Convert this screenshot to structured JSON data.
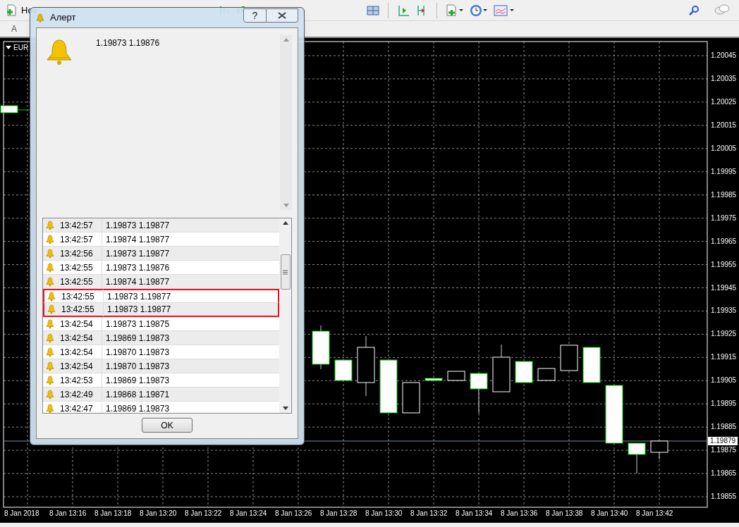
{
  "toolbar": {
    "new_order_label": "Нов",
    "row2_label": "A"
  },
  "chart": {
    "symbol": "EUR",
    "price_ticks": [
      "1.20045",
      "1.20035",
      "1.20025",
      "1.20015",
      "1.20005",
      "1.19995",
      "1.19985",
      "1.19975",
      "1.19965",
      "1.19955",
      "1.19945",
      "1.19935",
      "1.19925",
      "1.19915",
      "1.19905",
      "1.19895",
      "1.19885",
      "1.19875",
      "1.19865",
      "1.19855"
    ],
    "current_price": "1.19879",
    "time_labels": [
      "8 Jan 2018",
      "8 Jan 13:16",
      "8 Jan 13:18",
      "8 Jan 13:20",
      "8 Jan 13:22",
      "8 Jan 13:24",
      "8 Jan 13:26",
      "8 Jan 13:28",
      "8 Jan 13:30",
      "8 Jan 13:32",
      "8 Jan 13:34",
      "8 Jan 13:36",
      "8 Jan 13:38",
      "8 Jan 13:40",
      "8 Jan 13:42"
    ]
  },
  "alert_dialog": {
    "title": "Алерт",
    "help_glyph": "?",
    "message": "1.19873 1.19876",
    "history": [
      {
        "time": "13:42:57",
        "message": "1.19873 1.19877",
        "marked": false
      },
      {
        "time": "13:42:57",
        "message": "1.19874 1.19877",
        "marked": false
      },
      {
        "time": "13:42:56",
        "message": "1.19873 1.19877",
        "marked": false
      },
      {
        "time": "13:42:55",
        "message": "1.19873 1.19876",
        "marked": false
      },
      {
        "time": "13:42:55",
        "message": "1.19874 1.19877",
        "marked": false
      },
      {
        "time": "13:42:55",
        "message": "1.19873 1.19877",
        "marked": true
      },
      {
        "time": "13:42:55",
        "message": "1.19873 1.19877",
        "marked": true
      },
      {
        "time": "13:42:54",
        "message": "1.19873 1.19875",
        "marked": false
      },
      {
        "time": "13:42:54",
        "message": "1.19869 1.19873",
        "marked": false
      },
      {
        "time": "13:42:54",
        "message": "1.19870 1.19873",
        "marked": false
      },
      {
        "time": "13:42:54",
        "message": "1.19870 1.19873",
        "marked": false
      },
      {
        "time": "13:42:53",
        "message": "1.19869 1.19873",
        "marked": false
      },
      {
        "time": "13:42:49",
        "message": "1.19868 1.19871",
        "marked": false
      },
      {
        "time": "13:42:47",
        "message": "1.19869 1.19873",
        "marked": false
      }
    ],
    "ok_button": "OK"
  }
}
